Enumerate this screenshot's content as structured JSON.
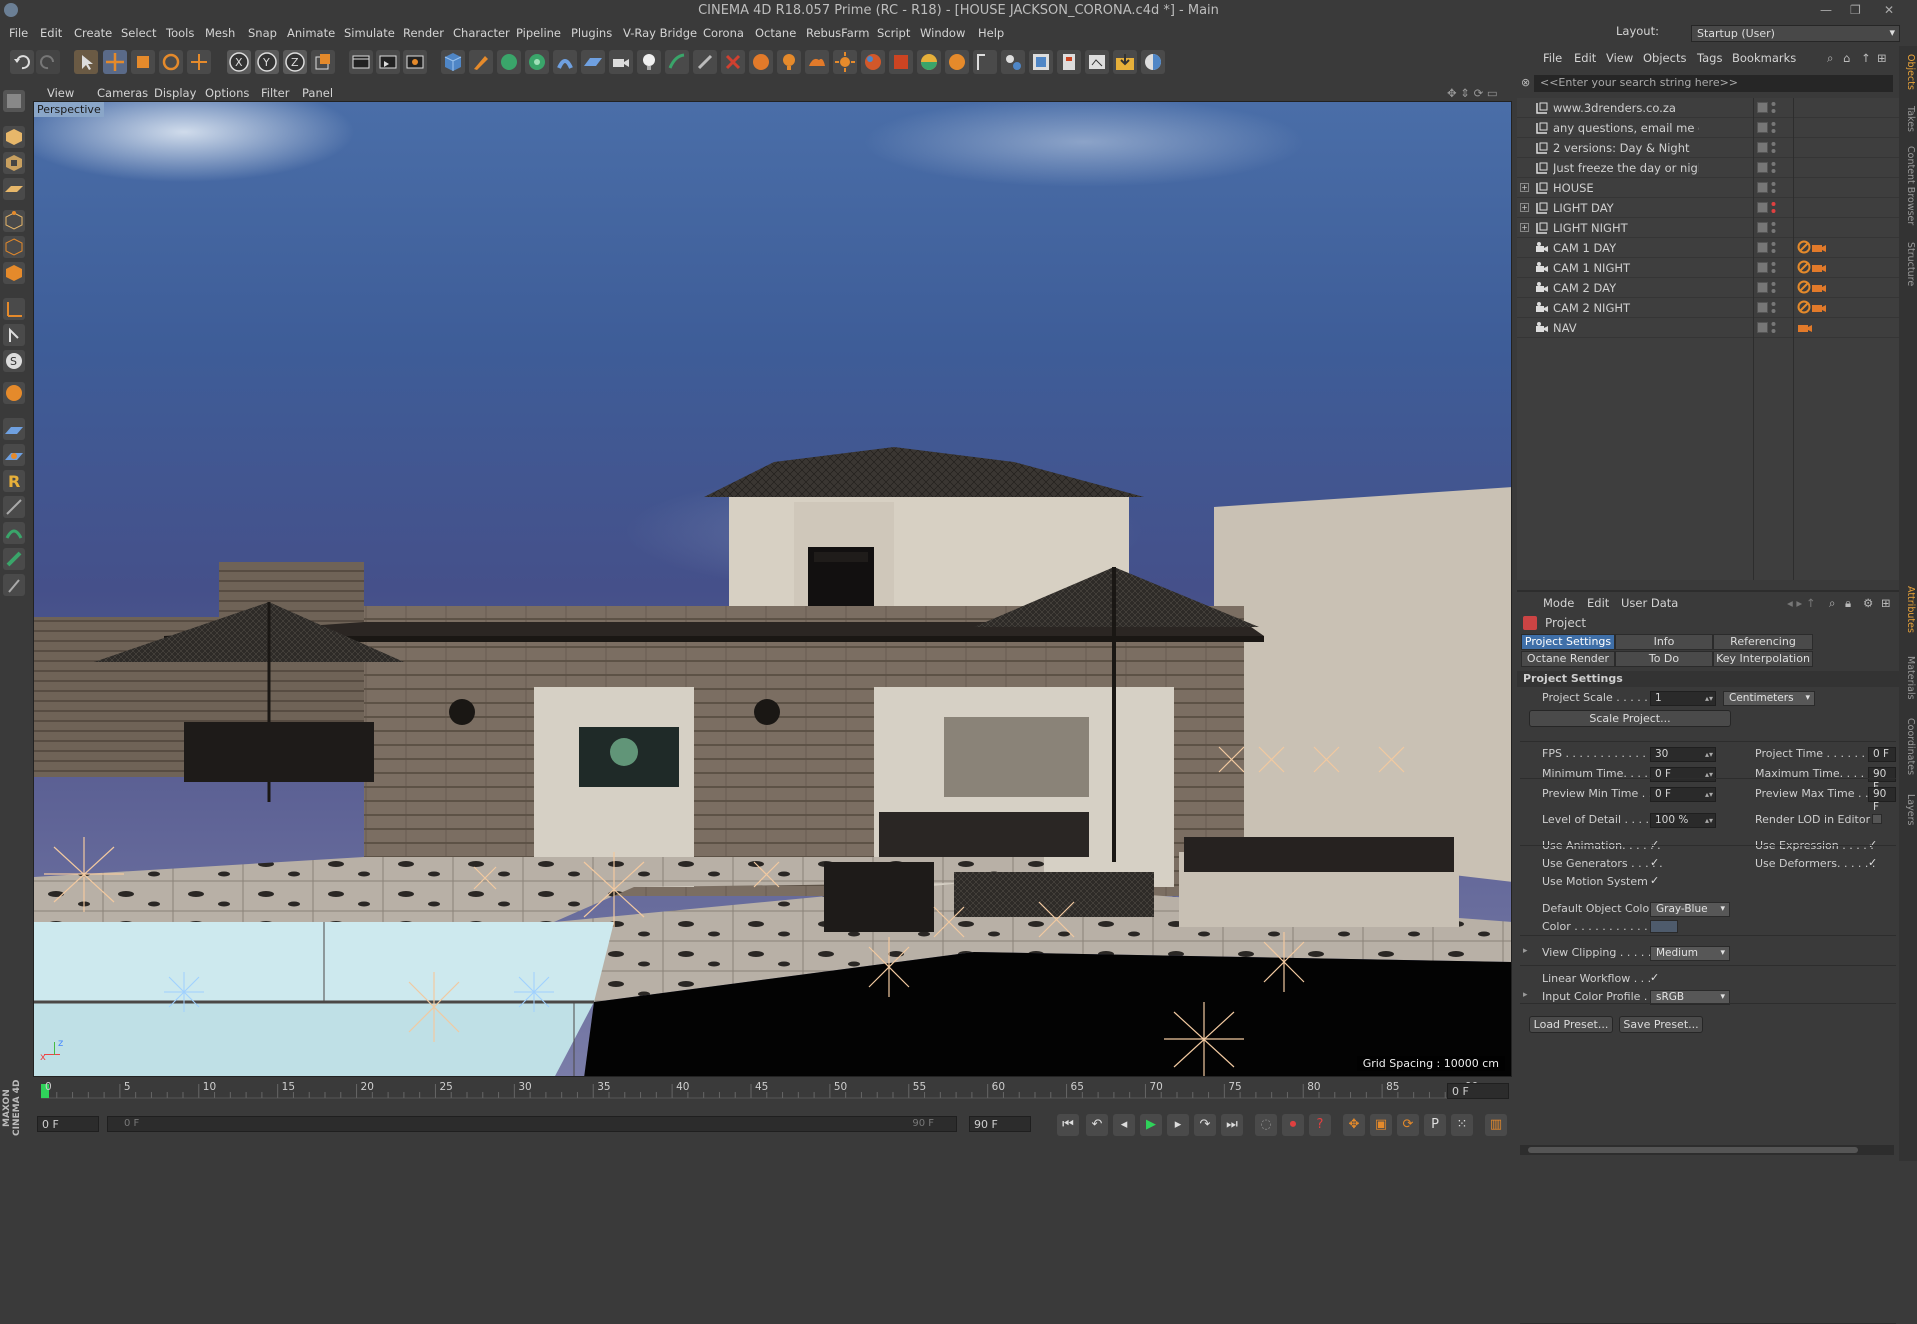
{
  "window": {
    "title": "CINEMA 4D R18.057 Prime (RC - R18) - [HOUSE JACKSON_CORONA.c4d *] - Main",
    "min": "—",
    "restore": "❐",
    "close": "✕"
  },
  "menubar": [
    "File",
    "Edit",
    "Create",
    "Select",
    "Tools",
    "Mesh",
    "Snap",
    "Animate",
    "Simulate",
    "Render",
    "Character",
    "Pipeline",
    "Plugins",
    "V-Ray Bridge",
    "Corona",
    "Octane",
    "RebusFarm",
    "Script",
    "Window",
    "Help"
  ],
  "layout": {
    "label": "Layout:",
    "value": "Startup (User)"
  },
  "viewport": {
    "menu": [
      "View",
      "Cameras",
      "Display",
      "Options",
      "Filter",
      "Panel"
    ],
    "camera_label": "Perspective",
    "grid_spacing": "Grid Spacing : 10000 cm",
    "axis_x": "x",
    "axis_z": "z"
  },
  "timeline": {
    "ticks": [
      "0",
      "5",
      "10",
      "15",
      "20",
      "25",
      "30",
      "35",
      "40",
      "45",
      "50",
      "55",
      "60",
      "65",
      "70",
      "75",
      "80",
      "85",
      "90"
    ],
    "current_frame": "0 F"
  },
  "transport": {
    "start_field": "0 F",
    "range_start": "0 F",
    "range_end": "90 F",
    "end_field": "90 F"
  },
  "branding": "MAXON CINEMA 4D",
  "objects_panel": {
    "menu": [
      "File",
      "Edit",
      "View",
      "Objects",
      "Tags",
      "Bookmarks"
    ],
    "search_placeholder": "<<Enter your search string here>>",
    "rows": [
      {
        "name": "www.3drenders.co.za",
        "type": "null",
        "expand": false
      },
      {
        "name": "any questions, email me on info@jireh",
        "type": "null",
        "expand": false
      },
      {
        "name": "2 versions: Day & Night",
        "type": "null",
        "expand": false
      },
      {
        "name": "Just freeze the day or night you dont n",
        "type": "null",
        "expand": false
      },
      {
        "name": "HOUSE",
        "type": "null",
        "expand": true
      },
      {
        "name": "LIGHT DAY",
        "type": "null",
        "expand": true
      },
      {
        "name": "LIGHT NIGHT",
        "type": "null",
        "expand": true
      },
      {
        "name": "CAM 1 DAY",
        "type": "camera",
        "expand": false
      },
      {
        "name": "CAM 1 NIGHT",
        "type": "camera",
        "expand": false
      },
      {
        "name": "CAM 2 DAY",
        "type": "camera",
        "expand": false
      },
      {
        "name": "CAM 2 NIGHT",
        "type": "camera",
        "expand": false
      },
      {
        "name": "NAV",
        "type": "camera",
        "expand": false
      }
    ]
  },
  "attributes": {
    "menu": [
      "Mode",
      "Edit",
      "User Data"
    ],
    "header": "Project",
    "tabs_row1": [
      "Project Settings",
      "Info",
      "Referencing"
    ],
    "tabs_row2": [
      "Octane Render",
      "To Do",
      "Key Interpolation"
    ],
    "section": "Project Settings",
    "project_scale": {
      "label": "Project Scale . . . . . .",
      "value": "1",
      "unit": "Centimeters"
    },
    "scale_button": "Scale Project...",
    "fps": {
      "label": "FPS . . . . . . . . . . . . . .",
      "value": "30"
    },
    "project_time": {
      "label": "Project Time . . . . . . . .",
      "value": "0 F"
    },
    "min_time": {
      "label": "Minimum Time. . . . . .",
      "value": "0 F"
    },
    "max_time": {
      "label": "Maximum Time. . . . . .",
      "value": "90 F"
    },
    "preview_min": {
      "label": "Preview Min Time . . .",
      "value": "0 F"
    },
    "preview_max": {
      "label": "Preview Max Time . . .",
      "value": "90 F"
    },
    "lod": {
      "label": "Level of Detail . . . . .",
      "value": "100 %"
    },
    "render_lod": "Render LOD in Editor",
    "use_animation": "Use Animation. . . . . .",
    "use_expression": "Use Expression . . . . .",
    "use_generators": "Use Generators . . . . .",
    "use_deformers": "Use Deformers. . . . . .",
    "use_motion": "Use Motion System",
    "default_color": {
      "label": "Default Object Color",
      "value": "Gray-Blue"
    },
    "color_label": "Color . . . . . . . . . . .",
    "view_clipping": {
      "label": "View Clipping . . . . .",
      "value": "Medium"
    },
    "linear_workflow": "Linear Workflow . . .",
    "input_profile": {
      "label": "Input Color Profile . .",
      "value": "sRGB"
    },
    "load_preset": "Load Preset...",
    "save_preset": "Save Preset...",
    "check": "✓"
  },
  "side_tabs": [
    "Objects",
    "Takes",
    "Content Browser",
    "Structure",
    "Attributes",
    "Materials",
    "Coordinates",
    "Layers"
  ],
  "colors": {
    "accent": "#3f6fa8",
    "orange": "#e58a2b",
    "bg": "#3a3a3a"
  }
}
